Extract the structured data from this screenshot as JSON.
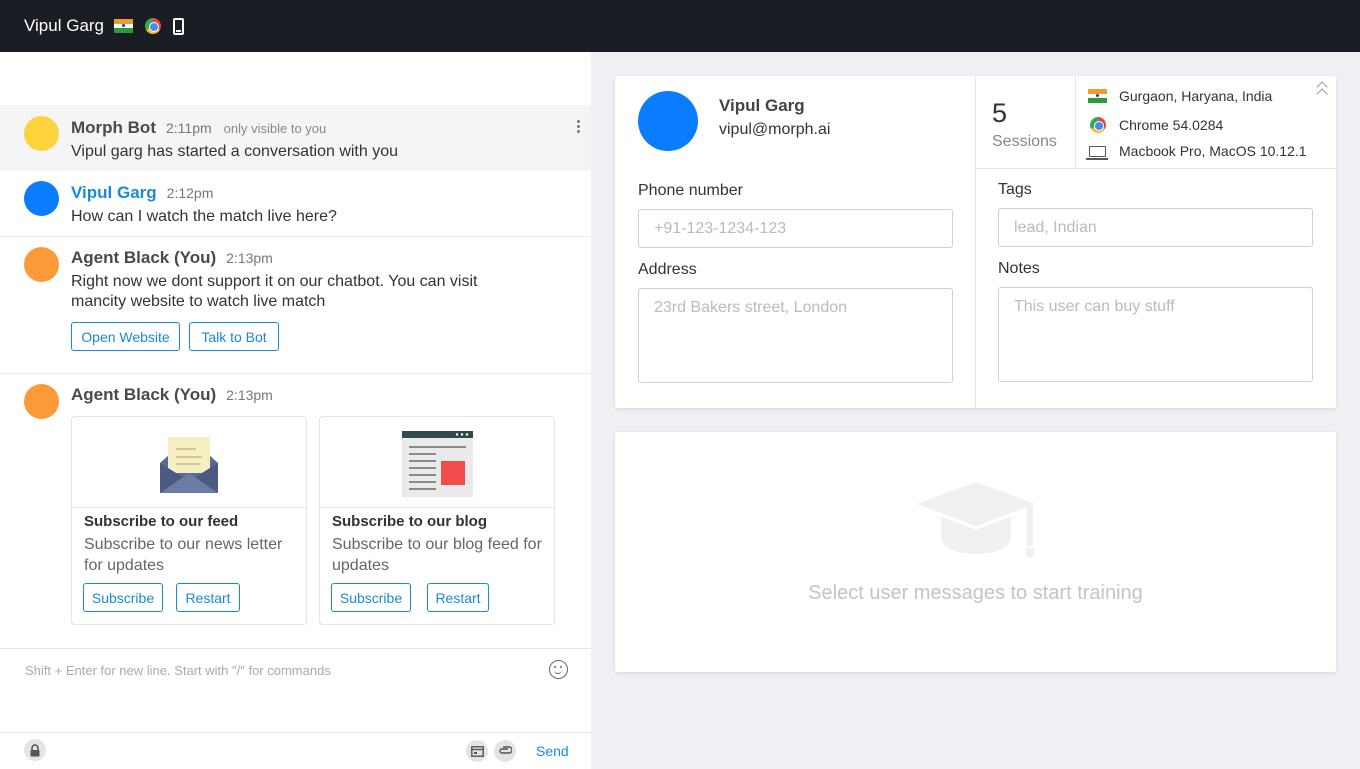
{
  "topbar": {
    "user_name": "Vipul Garg",
    "icons": [
      "india-flag-icon",
      "chrome-icon",
      "mobile-device-icon"
    ]
  },
  "chat": {
    "messages": [
      {
        "sender": "Morph Bot",
        "time": "2:11pm",
        "note": "only visible to you",
        "text": "Vipul garg has started a conversation with you",
        "avatar_color": "#fdd33c"
      },
      {
        "sender": "Vipul Garg",
        "time": "2:12pm",
        "text": "How can I watch the match live here?",
        "avatar_color": "#0a7cff"
      },
      {
        "sender": "Agent Black (You)",
        "time": "2:13pm",
        "text_line1": "Right now we dont support it on our chatbot. You can visit",
        "text_line2": "mancity website to watch live match",
        "buttons": [
          "Open Website",
          "Talk to Bot"
        ],
        "avatar_color": "#fd9a38"
      },
      {
        "sender": "Agent Black (You)",
        "time": "2:13pm",
        "avatar_color": "#fd9a38",
        "cards": [
          {
            "title": "Subscribe to our feed",
            "desc": "Subscribe to our news letter for updates",
            "buttons": [
              "Subscribe",
              "Restart"
            ],
            "image": "envelope-icon"
          },
          {
            "title": "Subscribe to our blog",
            "desc": "Subscribe to our blog feed for updates",
            "buttons": [
              "Subscribe",
              "Restart"
            ],
            "image": "blog-page-icon"
          }
        ]
      }
    ],
    "composer": {
      "placeholder": "Shift + Enter for new line. Start with \"/\" for commands",
      "send_label": "Send"
    }
  },
  "profile": {
    "name": "Vipul Garg",
    "email": "vipul@morph.ai",
    "sessions_count": "5",
    "sessions_label": "Sessions",
    "location": "Gurgaon, Haryana, India",
    "browser": "Chrome 54.0284",
    "device": "Macbook Pro, MacOS 10.12.1",
    "phone": {
      "label": "Phone number",
      "placeholder": "+91-123-1234-123"
    },
    "address": {
      "label": "Address",
      "placeholder": "23rd Bakers street, London"
    },
    "tags": {
      "label": "Tags",
      "placeholder": "lead, Indian"
    },
    "notes": {
      "label": "Notes",
      "placeholder": "This user can buy stuff"
    }
  },
  "training": {
    "message": "Select user messages to start training"
  },
  "colors": {
    "accent": "#1a8ad8",
    "topbar": "#1b1d24"
  }
}
